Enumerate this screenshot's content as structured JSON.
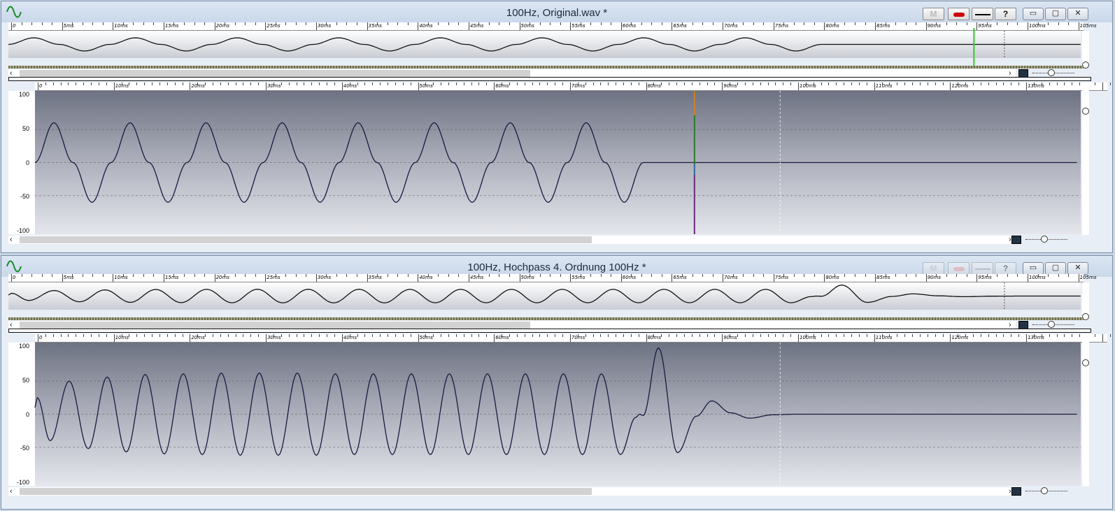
{
  "windows": [
    {
      "title": "100Hz, Original.wav *",
      "tools": {
        "marker": "M",
        "help": "?"
      },
      "controls": {
        "minimize": "▭",
        "restore": "▢",
        "close": "✕"
      },
      "overview_ticks": [
        "0",
        "5ms",
        "10ms",
        "15ms",
        "20ms",
        "25ms",
        "30ms",
        "35ms",
        "40ms",
        "45ms",
        "50ms",
        "55ms",
        "60ms",
        "65ms",
        "70ms",
        "75ms",
        "80ms",
        "85ms",
        "90ms",
        "95ms",
        "100ms",
        "105ms"
      ],
      "main_ticks": [
        "0",
        "10ms",
        "20ms",
        "30ms",
        "40ms",
        "50ms",
        "60ms",
        "70ms",
        "80ms",
        "90ms",
        "100ms",
        "110ms",
        "120ms",
        "130ms"
      ],
      "y_ticks": [
        "100",
        "50",
        "0",
        "-50",
        "-100"
      ],
      "cursor_ms": 95,
      "marker_ms": 98
    },
    {
      "title": "100Hz, Hochpass 4. Ordnung 100Hz *",
      "tools": {
        "marker": "M",
        "help": "?"
      },
      "controls": {
        "minimize": "▭",
        "restore": "▢",
        "close": "✕"
      },
      "overview_ticks": [
        "0",
        "5ms",
        "10ms",
        "15ms",
        "20ms",
        "25ms",
        "30ms",
        "35ms",
        "40ms",
        "45ms",
        "50ms",
        "55ms",
        "60ms",
        "65ms",
        "70ms",
        "75ms",
        "80ms",
        "85ms",
        "90ms",
        "95ms",
        "100ms",
        "105ms"
      ],
      "main_ticks": [
        "0",
        "10ms",
        "20ms",
        "30ms",
        "40ms",
        "50ms",
        "60ms",
        "70ms",
        "80ms",
        "90ms",
        "100ms",
        "110ms",
        "120ms",
        "130ms"
      ],
      "y_ticks": [
        "100",
        "50",
        "0",
        "-50",
        "-100"
      ],
      "marker_ms": 98
    }
  ],
  "chart_data": [
    {
      "type": "line",
      "xlabel": "",
      "ylabel": "",
      "xlim": [
        0,
        137
      ],
      "ylim": [
        -105,
        105
      ],
      "series": [
        {
          "x": [
            0,
            2.5,
            5,
            7.5,
            10,
            12.5,
            15,
            17.5,
            20,
            22.5,
            25,
            27.5,
            30,
            32.5,
            35,
            37.5,
            40,
            42.5,
            45,
            47.5,
            50,
            52.5,
            55,
            57.5,
            60,
            62.5,
            65,
            67.5,
            70,
            72.5,
            75,
            77.5,
            80,
            137
          ],
          "y": [
            0,
            60,
            0,
            -60,
            0,
            60,
            0,
            -60,
            0,
            60,
            0,
            -60,
            0,
            60,
            0,
            -60,
            0,
            60,
            0,
            -60,
            0,
            60,
            0,
            -60,
            0,
            60,
            0,
            -60,
            0,
            60,
            0,
            -60,
            0,
            0
          ]
        }
      ]
    },
    {
      "type": "line",
      "xlabel": "",
      "ylabel": "",
      "xlim": [
        0,
        137
      ],
      "ylim": [
        -105,
        105
      ],
      "series": [
        {
          "x": [
            0,
            0.3,
            2,
            4.5,
            7,
            9.5,
            12,
            14.5,
            17,
            19.5,
            22,
            24.5,
            27,
            29.5,
            32,
            34.5,
            37,
            39.5,
            42,
            44.5,
            47,
            49.5,
            52,
            54.5,
            57,
            59.5,
            62,
            64.5,
            67,
            69.5,
            72,
            74.5,
            77,
            79,
            79.5,
            80,
            82,
            84.5,
            87,
            89,
            91.5,
            94,
            97,
            100,
            137
          ],
          "y": [
            10,
            25,
            -40,
            50,
            -52,
            56,
            -57,
            60,
            -60,
            61,
            -61,
            62,
            -62,
            62,
            -62,
            62,
            -62,
            61,
            -61,
            61,
            -61,
            61,
            -61,
            61,
            -61,
            61,
            -61,
            61,
            -61,
            61,
            -61,
            61,
            -61,
            -5,
            0,
            -2,
            100,
            -58,
            -3,
            20,
            2,
            -6,
            -1,
            0,
            0
          ]
        }
      ]
    }
  ]
}
